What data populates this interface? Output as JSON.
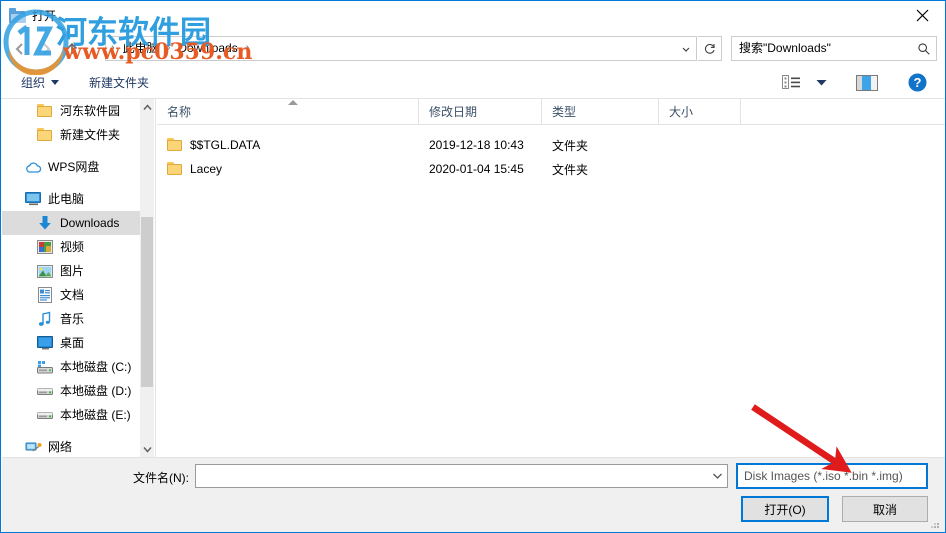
{
  "window": {
    "title": "打开",
    "title_icon": "folder-icon",
    "close_label": "✕"
  },
  "nav": {
    "back_icon": "back-arrow-icon",
    "forward_icon": "forward-arrow-icon",
    "up_icon": "up-arrow-icon",
    "breadcrumbs": [
      {
        "label": "此电脑"
      },
      {
        "label": "Downloads"
      }
    ],
    "separator": "›",
    "dropdown_icon": "chevron-down-icon",
    "refresh_icon": "refresh-icon"
  },
  "search": {
    "placeholder": "搜索\"Downloads\"",
    "icon": "search-icon"
  },
  "toolbar": {
    "organize_label": "组织",
    "new_folder_label": "新建文件夹",
    "view_icon": "view-options-icon",
    "view_caret_icon": "chevron-down-icon",
    "preview_pane_icon": "preview-pane-icon",
    "help_icon": "help-icon",
    "help_glyph": "?"
  },
  "sidebar": {
    "items": [
      {
        "label": "河东软件园",
        "icon": "folder-icon",
        "indent": 1,
        "selected": false
      },
      {
        "label": "新建文件夹",
        "icon": "folder-icon",
        "indent": 1,
        "selected": false
      },
      {
        "label": "WPS网盘",
        "icon": "cloud-icon",
        "indent": 0,
        "selected": false
      },
      {
        "label": "此电脑",
        "icon": "this-pc-icon",
        "indent": 0,
        "selected": false
      },
      {
        "label": "Downloads",
        "icon": "downloads-icon",
        "indent": 1,
        "selected": true
      },
      {
        "label": "视频",
        "icon": "videos-icon",
        "indent": 1,
        "selected": false
      },
      {
        "label": "图片",
        "icon": "pictures-icon",
        "indent": 1,
        "selected": false
      },
      {
        "label": "文档",
        "icon": "documents-icon",
        "indent": 1,
        "selected": false
      },
      {
        "label": "音乐",
        "icon": "music-icon",
        "indent": 1,
        "selected": false
      },
      {
        "label": "桌面",
        "icon": "desktop-icon",
        "indent": 1,
        "selected": false
      },
      {
        "label": "本地磁盘 (C:)",
        "icon": "system-drive-icon",
        "indent": 1,
        "selected": false
      },
      {
        "label": "本地磁盘 (D:)",
        "icon": "drive-icon",
        "indent": 1,
        "selected": false
      },
      {
        "label": "本地磁盘 (E:)",
        "icon": "drive-icon",
        "indent": 1,
        "selected": false
      },
      {
        "label": "网络",
        "icon": "network-icon",
        "indent": 0,
        "selected": false
      }
    ],
    "scroll_up_icon": "chevron-up-icon",
    "scroll_down_icon": "chevron-down-icon"
  },
  "filelist": {
    "columns": [
      {
        "label": "名称",
        "sorted": "asc"
      },
      {
        "label": "修改日期",
        "sorted": ""
      },
      {
        "label": "类型",
        "sorted": ""
      },
      {
        "label": "大小",
        "sorted": ""
      }
    ],
    "rows": [
      {
        "name": "$$TGL.DATA",
        "date": "2019-12-18 10:43",
        "type": "文件夹",
        "size": "",
        "icon": "folder-icon"
      },
      {
        "name": "Lacey",
        "date": "2020-01-04 15:45",
        "type": "文件夹",
        "size": "",
        "icon": "folder-icon"
      }
    ]
  },
  "footer": {
    "filename_label": "文件名(N):",
    "filename_value": "",
    "filename_caret_icon": "chevron-down-icon",
    "filetype_value": "Disk Images (*.iso *.bin *.img)",
    "open_button": "打开(O)",
    "cancel_button": "取消",
    "resize_grip_icon": "resize-grip-icon"
  },
  "annotation": {
    "arrow_icon": "red-arrow-icon",
    "arrow_color": "#e01b1b"
  },
  "watermark": {
    "site_name": "河东软件园",
    "url": "www.pc0359.cn",
    "logo_icon": "site-logo-icon",
    "name_color": "#2f9fe0",
    "url_color": "#e85a24"
  }
}
